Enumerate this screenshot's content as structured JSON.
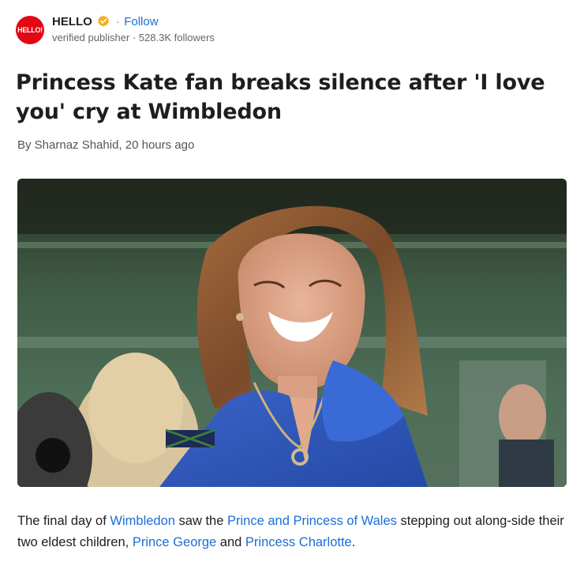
{
  "publisher": {
    "logo_text": "HELLO!",
    "name": "HELLO",
    "follow_label": "Follow",
    "separator": "·",
    "meta": "verified publisher · 528.3K followers"
  },
  "article": {
    "headline": "Princess Kate fan breaks silence after 'I love you' cry at Wimbledon",
    "byline": "By Sharnaz Shahid, 20 hours ago",
    "paragraph": {
      "t1": "The final day of ",
      "link1": "Wimbledon",
      "t2": " saw the ",
      "link2": "Prince and Princess of Wales",
      "t3": " stepping out along-side their two eldest children, ",
      "link3": "Prince George",
      "t4": " and ",
      "link4": "Princess Charlotte",
      "t5": "."
    }
  },
  "icons": {
    "verified": "verified-badge-icon"
  },
  "colors": {
    "link": "#1a6ed8",
    "logo": "#e30613",
    "verified": "#f2b01e"
  }
}
